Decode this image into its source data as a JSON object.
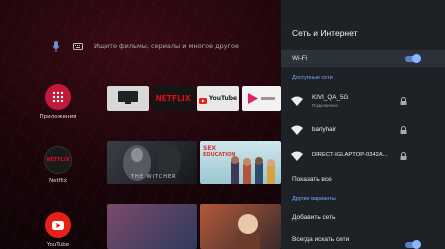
{
  "home": {
    "search_placeholder": "Ищите фильмы, сериалы и многое другое",
    "apps": [
      {
        "label": "Приложения",
        "icon": "apps-grid-icon"
      },
      {
        "label": "Netflix",
        "icon": "netflix-logo"
      },
      {
        "label": "YouTube",
        "icon": "youtube-logo"
      }
    ],
    "tiles": {
      "netflix": "NETFLIX",
      "youtube": "YouTube",
      "sex_education_1": "SEX",
      "sex_education_2": "EDUCATION",
      "witcher": "THE WITCHER"
    }
  },
  "panel": {
    "title": "Сеть и Интернет",
    "wifi_label": "Wi-Fi",
    "wifi_on": true,
    "available_section": "Доступные сети",
    "networks": [
      {
        "name": "KIVI_QA_5G",
        "status": "Подключено",
        "locked": true
      },
      {
        "name": "barlyhair",
        "status": "",
        "locked": true
      },
      {
        "name": "DIRECT-IGLAPTOP-0342A...",
        "status": "",
        "locked": true
      }
    ],
    "show_all": "Показать все",
    "other_section": "Другие варианты",
    "add_network": "Добавить сеть",
    "always_scan": "Всегда искать сети"
  },
  "colors": {
    "accent": "#7fa7ff",
    "netflix_red": "#e50914",
    "panel_bg": "#1e2227"
  }
}
